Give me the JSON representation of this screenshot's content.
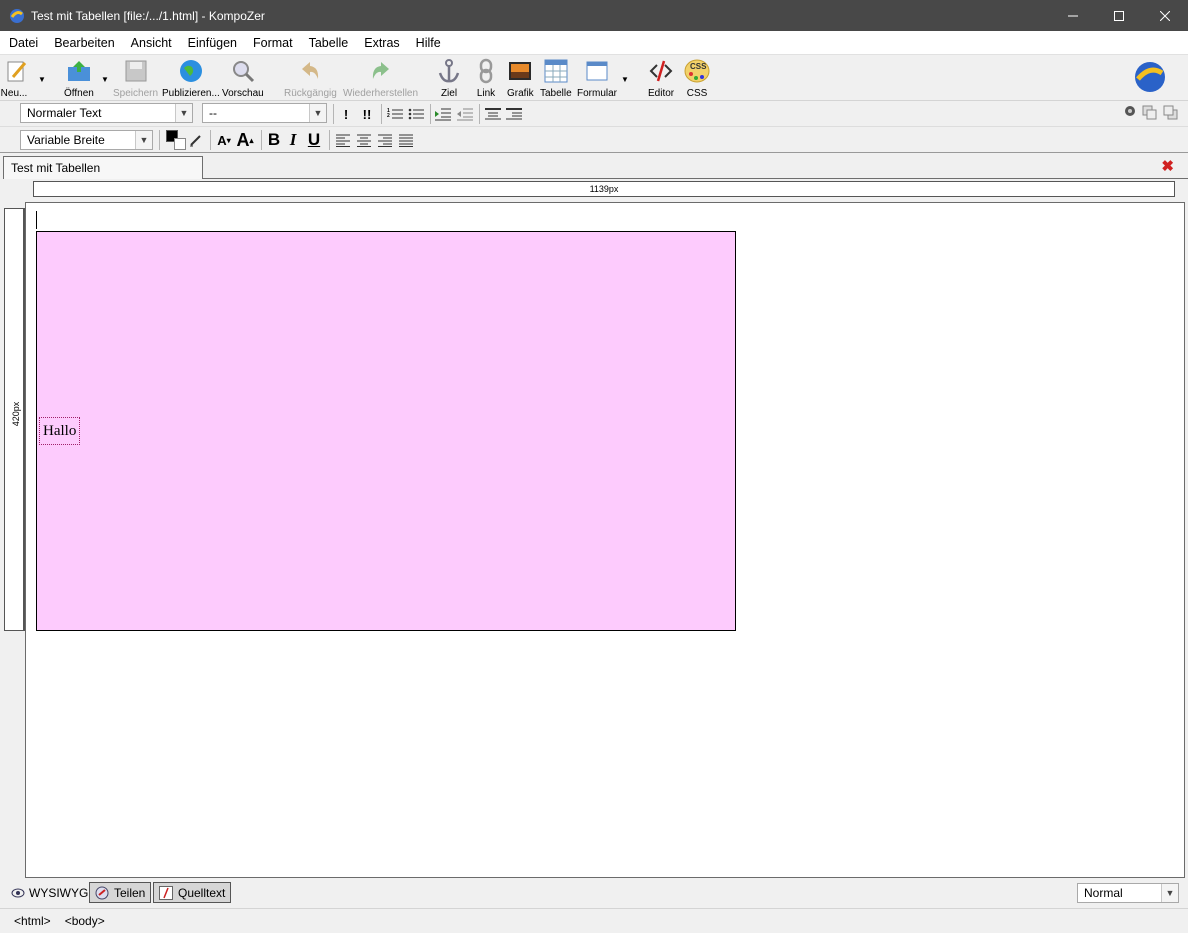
{
  "window": {
    "title": "Test mit Tabellen [file:/.../1.html] - KompoZer"
  },
  "menu": [
    "Datei",
    "Bearbeiten",
    "Ansicht",
    "Einfügen",
    "Format",
    "Tabelle",
    "Extras",
    "Hilfe"
  ],
  "toolbar": {
    "new": "Neu...",
    "open": "Öffnen",
    "save": "Speichern",
    "publish": "Publizieren...",
    "preview": "Vorschau",
    "undo": "Rückgängig",
    "redo": "Wiederherstellen",
    "anchor": "Ziel",
    "link": "Link",
    "image": "Grafik",
    "table": "Tabelle",
    "form": "Formular",
    "editor": "Editor",
    "css": "CSS"
  },
  "format": {
    "paragraph_style": "Normaler Text",
    "class": "--",
    "font": "Variable Breite",
    "text_color": "#000000"
  },
  "document": {
    "tab_title": "Test mit Tabellen",
    "width_ruler": "1139px",
    "height_ruler": "420px",
    "cell_text": "Hallo",
    "table_bg": "#fdcbfd"
  },
  "modes": {
    "wysiwyg": "WYSIWYG",
    "split": "Teilen",
    "source": "Quelltext",
    "zoom": "Normal"
  },
  "status": {
    "tag1": "<html>",
    "tag2": "<body>"
  }
}
